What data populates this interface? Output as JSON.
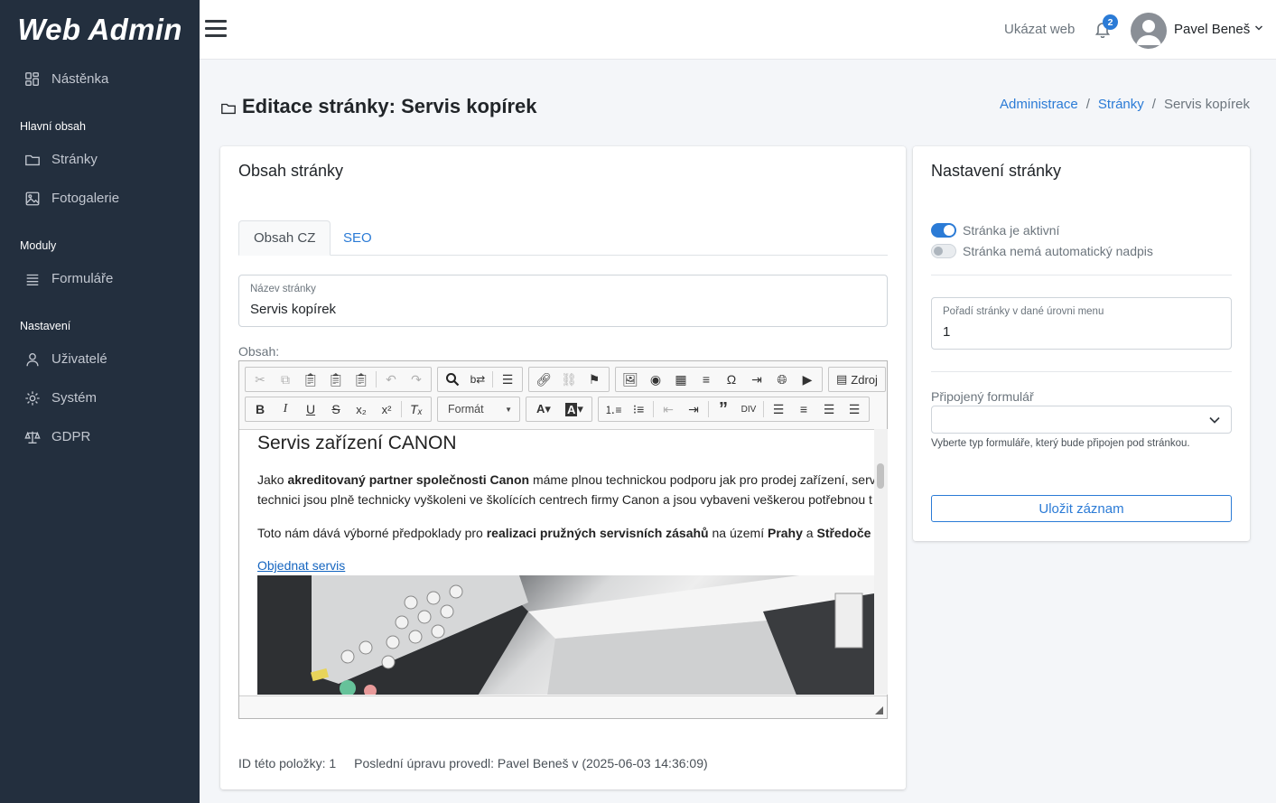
{
  "brand": "Web Admin",
  "sidebar": {
    "dashboard": "Nástěnka",
    "section_main": "Hlavní obsah",
    "pages": "Stránky",
    "gallery": "Fotogalerie",
    "section_modules": "Moduly",
    "forms": "Formuláře",
    "section_settings": "Nastavení",
    "users": "Uživatelé",
    "system": "Systém",
    "gdpr": "GDPR"
  },
  "topbar": {
    "show_web": "Ukázat web",
    "notifications": "2",
    "user_name": "Pavel Beneš"
  },
  "page": {
    "title": "Editace stránky: Servis kopírek",
    "breadcrumb": [
      "Administrace",
      "Stránky",
      "Servis kopírek"
    ]
  },
  "main_card": {
    "title": "Obsah stránky",
    "tabs": [
      "Obsah CZ",
      "SEO"
    ],
    "name_label": "Název stránky",
    "name_value": "Servis kopírek",
    "content_label": "Obsah:",
    "toolbar": {
      "format_label": "Formát",
      "source_label": "Zdroj"
    },
    "content": {
      "heading": "Servis zařízení CANON",
      "p1_a": "Jako ",
      "p1_b": "akreditovaný partner společnosti Canon",
      "p1_c": " máme plnou technickou podporu jak pro prodej zařízení, serv",
      "p1_line2": "technici jsou plně technicky vyškoleni ve školících centrech firmy Canon a jsou vybaveni veškerou potřebnou t",
      "p2_a": "Toto nám dává výborné předpoklady pro ",
      "p2_b": "realizaci pružných servisních zásahů",
      "p2_c": " na území ",
      "p2_d": "Prahy",
      "p2_e": " a ",
      "p2_f": "Středoče",
      "link": "Objednat servis"
    },
    "footer": {
      "id_text": "ID této položky: 1",
      "last_edit": "Poslední úpravu provedl: Pavel Beneš v (2025-06-03 14:36:09)"
    }
  },
  "side_card": {
    "title": "Nastavení stránky",
    "switch_active": "Stránka je aktivní",
    "switch_active_on": true,
    "switch_no_heading": "Stránka nemá automatický nadpis",
    "switch_no_heading_on": false,
    "order_label": "Pořadí stránky v dané úrovni menu",
    "order_value": "1",
    "form_label": "Připojený formulář",
    "form_value": "",
    "form_help": "Vyberte typ formuláře, který bude připojen pod stránkou.",
    "save_button": "Uložit záznam"
  },
  "colors": {
    "sidebar_bg": "#232f3e",
    "accent": "#2b7bd6",
    "page_bg": "#f4f6f9"
  }
}
